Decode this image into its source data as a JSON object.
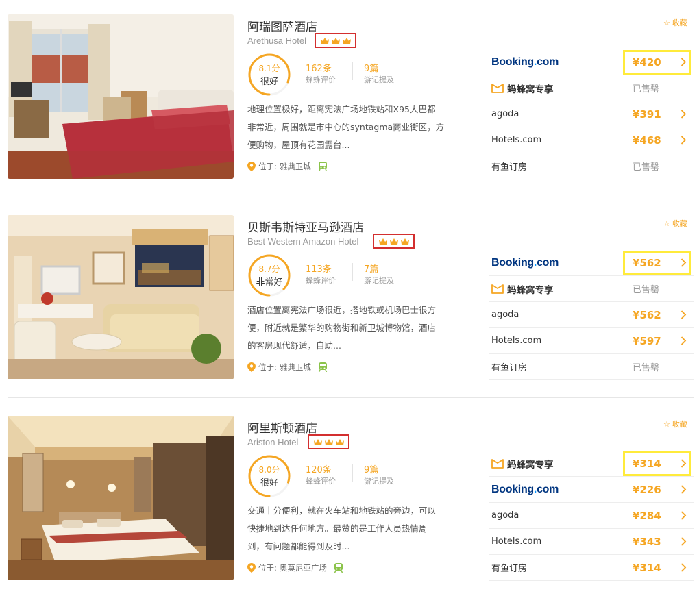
{
  "labels": {
    "favorite": "收藏",
    "reviews_label": "蜂蜂评价",
    "notes_label": "游记提及",
    "location_prefix": "位于:"
  },
  "colors": {
    "accent": "#f5a623",
    "crown_box": "#d32f2f",
    "price_highlight": "#ffeb3b",
    "booking_blue": "#003580"
  },
  "hotels": [
    {
      "name_cn": "阿瑞图萨酒店",
      "name_en": "Arethusa Hotel",
      "crowns": 3,
      "score": "8.1分",
      "score_label": "很好",
      "score_fraction": 0.81,
      "reviews": "162条",
      "notes": "9篇",
      "desc_lines": [
        "地理位置极好，距离宪法广场地铁站和X95大巴都",
        "非常近，周围就是市中心的syntagma商业街区，方",
        "便购物，屋顶有花园露台..."
      ],
      "location": "雅典卫城",
      "otas": [
        {
          "name": "Booking.com",
          "logo": "booking",
          "price": "¥420",
          "highlight": true
        },
        {
          "name": "蚂蜂窝专享",
          "logo": "mafengwo",
          "price": null,
          "status": "已售罄"
        },
        {
          "name": "agoda",
          "logo": "text",
          "price": "¥391"
        },
        {
          "name": "Hotels.com",
          "logo": "text",
          "price": "¥468"
        },
        {
          "name": "有鱼订房",
          "logo": "text",
          "price": null,
          "status": "已售罄"
        }
      ]
    },
    {
      "name_cn": "贝斯韦斯特亚马逊酒店",
      "name_en": "Best Western Amazon Hotel",
      "crowns": 3,
      "score": "8.7分",
      "score_label": "非常好",
      "score_fraction": 0.87,
      "reviews": "113条",
      "notes": "7篇",
      "desc_lines": [
        "酒店位置离宪法广场很近，搭地铁或机场巴士很方",
        "便，附近就是繁华的购物街和新卫城博物馆，酒店",
        "的客房现代舒适，自助..."
      ],
      "location": "雅典卫城",
      "otas": [
        {
          "name": "Booking.com",
          "logo": "booking",
          "price": "¥562",
          "highlight": true
        },
        {
          "name": "蚂蜂窝专享",
          "logo": "mafengwo",
          "price": null,
          "status": "已售罄"
        },
        {
          "name": "agoda",
          "logo": "text",
          "price": "¥562"
        },
        {
          "name": "Hotels.com",
          "logo": "text",
          "price": "¥597"
        },
        {
          "name": "有鱼订房",
          "logo": "text",
          "price": null,
          "status": "已售罄"
        }
      ]
    },
    {
      "name_cn": "阿里斯顿酒店",
      "name_en": "Ariston Hotel",
      "crowns": 3,
      "score": "8.0分",
      "score_label": "很好",
      "score_fraction": 0.8,
      "reviews": "120条",
      "notes": "9篇",
      "desc_lines": [
        "交通十分便利，就在火车站和地铁站的旁边，可以",
        "快捷地到达任何地方。最赞的是工作人员热情周",
        "到，有问题都能得到及时..."
      ],
      "location": "奥莫尼亚广场",
      "otas": [
        {
          "name": "蚂蜂窝专享",
          "logo": "mafengwo",
          "price": "¥314",
          "highlight": true
        },
        {
          "name": "Booking.com",
          "logo": "booking",
          "price": "¥226"
        },
        {
          "name": "agoda",
          "logo": "text",
          "price": "¥284"
        },
        {
          "name": "Hotels.com",
          "logo": "text",
          "price": "¥343"
        },
        {
          "name": "有鱼订房",
          "logo": "text",
          "price": "¥314"
        }
      ]
    }
  ]
}
